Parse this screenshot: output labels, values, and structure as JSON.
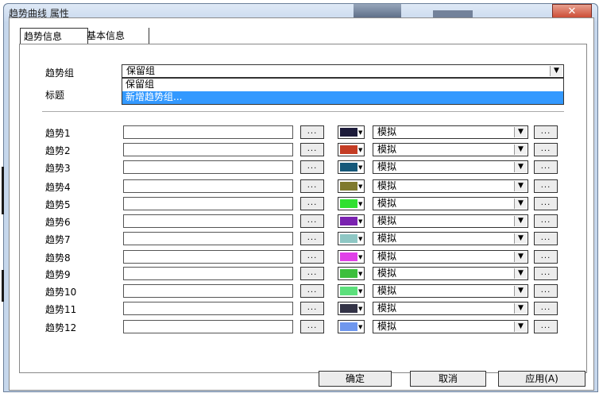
{
  "window": {
    "title": "趋势曲线 属性",
    "close_label": "✕"
  },
  "tabs": [
    {
      "label": "趋势信息"
    },
    {
      "label": "基本信息"
    }
  ],
  "group_label": "趋势组",
  "group_value": "保留组",
  "title_label": "标题",
  "dropdown_items": [
    "保留组",
    "新增趋势组..."
  ],
  "dots_label": "...",
  "mode_default": "模拟",
  "trends": [
    {
      "label": "趋势1",
      "value": "",
      "color": "#1c1b3a",
      "mode": "模拟"
    },
    {
      "label": "趋势2",
      "value": "",
      "color": "#c43c24",
      "mode": "模拟"
    },
    {
      "label": "趋势3",
      "value": "",
      "color": "#15587a",
      "mode": "模拟"
    },
    {
      "label": "趋势4",
      "value": "",
      "color": "#7f7a2e",
      "mode": "模拟"
    },
    {
      "label": "趋势5",
      "value": "",
      "color": "#30e030",
      "mode": "模拟"
    },
    {
      "label": "趋势6",
      "value": "",
      "color": "#7a22b0",
      "mode": "模拟"
    },
    {
      "label": "趋势7",
      "value": "",
      "color": "#8ec7c4",
      "mode": "模拟"
    },
    {
      "label": "趋势8",
      "value": "",
      "color": "#e040e8",
      "mode": "模拟"
    },
    {
      "label": "趋势9",
      "value": "",
      "color": "#3cbf3c",
      "mode": "模拟"
    },
    {
      "label": "趋势10",
      "value": "",
      "color": "#5ce07c",
      "mode": "模拟"
    },
    {
      "label": "趋势11",
      "value": "",
      "color": "#333347",
      "mode": "模拟"
    },
    {
      "label": "趋势12",
      "value": "",
      "color": "#6f97ee",
      "mode": "模拟"
    }
  ],
  "buttons": {
    "ok": "确定",
    "cancel": "取消",
    "apply": "应用(A)"
  }
}
